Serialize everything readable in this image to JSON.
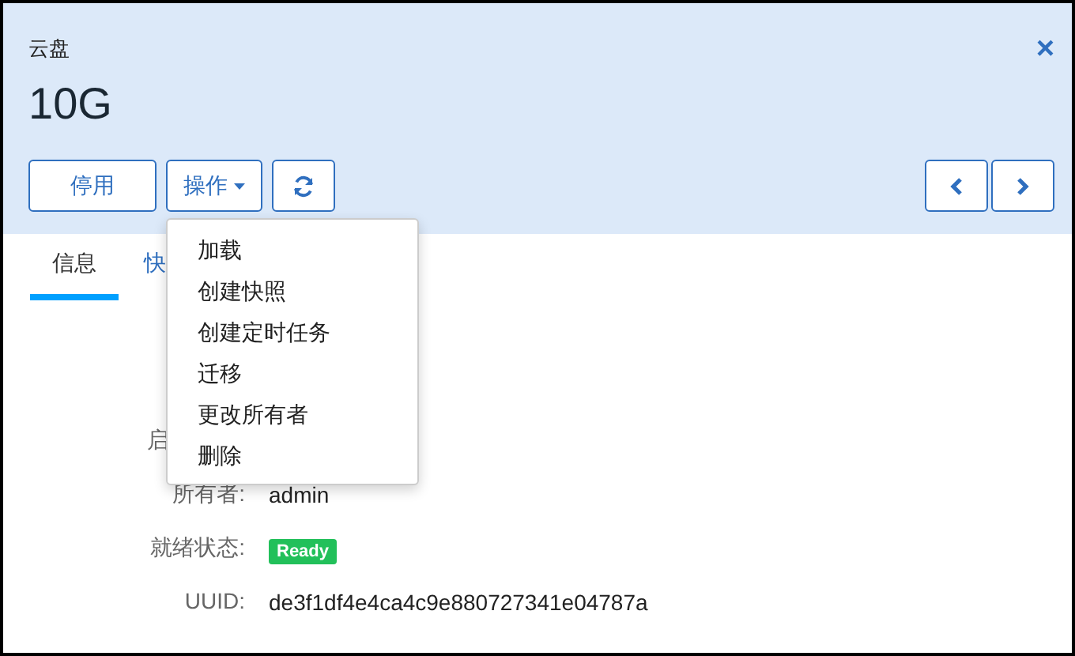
{
  "header": {
    "subtitle": "云盘",
    "title": "10G",
    "close": "×"
  },
  "buttons": [
    {
      "kind": "text",
      "label": "停用"
    },
    {
      "kind": "dropdown",
      "label": "操作",
      "expanded": true
    },
    {
      "kind": "refresh"
    }
  ],
  "nav": [
    {
      "kind": "prev"
    },
    {
      "kind": "next"
    }
  ],
  "tabs": [
    {
      "label": "信息",
      "selected": true
    },
    {
      "label": "快",
      "selected": false
    }
  ],
  "menu": [
    "加载",
    "创建快照",
    "创建定时任务",
    "迁移",
    "更改所有者",
    "删除"
  ],
  "fields": [
    {
      "kind": "partial",
      "label": "启"
    },
    {
      "kind": "text",
      "label": "所有者:",
      "value": "admin"
    },
    {
      "kind": "badge",
      "label": "就绪状态:",
      "value": "Ready"
    },
    {
      "kind": "text",
      "label": "UUID:",
      "value": "de3f1df4e4ca4c9e880727341e04787a"
    }
  ]
}
